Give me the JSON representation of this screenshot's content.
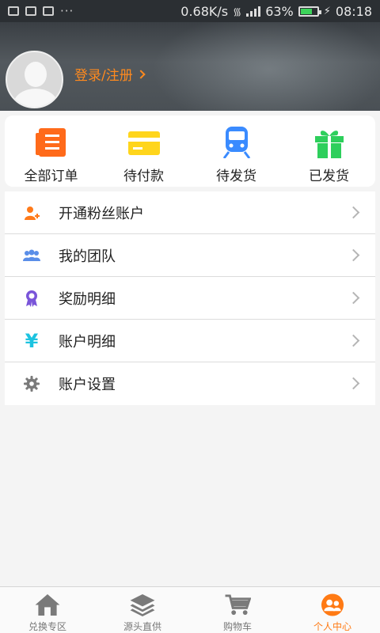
{
  "status_bar": {
    "dots": "···",
    "net_speed": "0.68K/s",
    "battery": "63%",
    "time": "08:18"
  },
  "header": {
    "login_text": "登录/注册"
  },
  "orders": [
    {
      "label": "全部订单",
      "icon": "list-doc-icon",
      "color": "#ff6a1a"
    },
    {
      "label": "待付款",
      "icon": "card-icon",
      "color": "#ffd51c"
    },
    {
      "label": "待发货",
      "icon": "train-icon",
      "color": "#3a8bff"
    },
    {
      "label": "已发货",
      "icon": "gift-icon",
      "color": "#2ecf5c"
    }
  ],
  "menu": [
    {
      "label": "开通粉丝账户",
      "icon": "add-person-icon",
      "color": "#ff7a1a"
    },
    {
      "label": "我的团队",
      "icon": "team-icon",
      "color": "#5a8ee8"
    },
    {
      "label": "奖励明细",
      "icon": "award-icon",
      "color": "#7a55d9"
    },
    {
      "label": "账户明细",
      "icon": "yen-icon",
      "color": "#1cc3e0"
    },
    {
      "label": "账户设置",
      "icon": "gear-icon",
      "color": "#777777"
    }
  ],
  "tabs": [
    {
      "label": "兑换专区",
      "icon": "home-icon",
      "active": false
    },
    {
      "label": "源头直供",
      "icon": "layers-icon",
      "active": false
    },
    {
      "label": "购物车",
      "icon": "cart-icon",
      "active": false
    },
    {
      "label": "个人中心",
      "icon": "user-center-icon",
      "active": true
    }
  ]
}
